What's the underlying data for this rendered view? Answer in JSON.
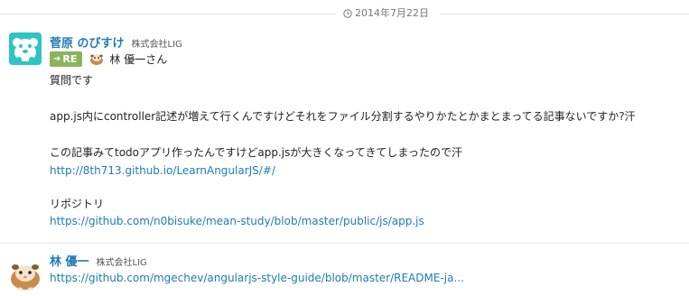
{
  "date_divider": {
    "label": "2014年7月22日"
  },
  "messages": [
    {
      "sender": "菅原 のびすけ",
      "company": "株式会社LIG",
      "reply": {
        "badge": "RE",
        "to": "林 優一さん"
      },
      "lines": {
        "l1": "質問です",
        "l2": "app.js内にcontroller記述が増えて行くんですけどそれをファイル分割するやりかたとかまとまってる記事ないですか?汗",
        "l3": "この記事みてtodoアプリ作ったんですけどapp.jsが大きくなってきてしまったので汗",
        "link1": "http://8th713.github.io/LearnAngularJS/#/",
        "l4": "リポジトリ",
        "link2": "https://github.com/n0bisuke/mean-study/blob/master/public/js/app.js"
      },
      "avatar_color": "#2ec4c1"
    },
    {
      "sender": "林 優一",
      "company": "株式会社LIG",
      "lines": {
        "link1": "https://github.com/mgechev/angularjs-style-guide/blob/master/README-ja..."
      }
    }
  ],
  "colors": {
    "link": "#1f7bb6",
    "badge": "#8cb35a",
    "divider": "#e3e3e3"
  },
  "icons": {
    "date": "clock-icon",
    "badge": "reply-arrow-icon"
  }
}
